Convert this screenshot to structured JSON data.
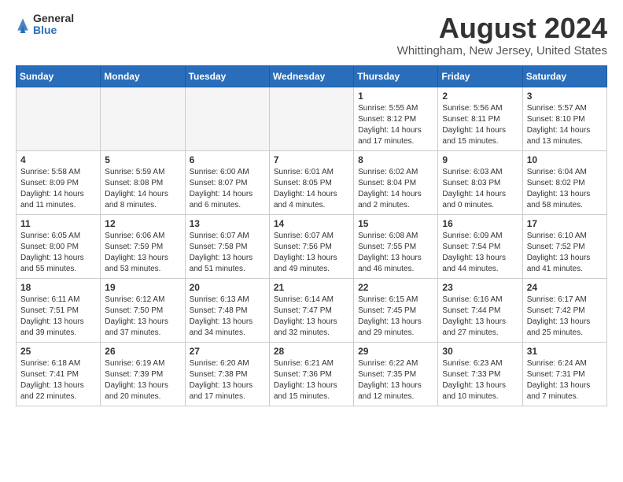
{
  "logo": {
    "general": "General",
    "blue": "Blue"
  },
  "title": "August 2024",
  "location": "Whittingham, New Jersey, United States",
  "headers": [
    "Sunday",
    "Monday",
    "Tuesday",
    "Wednesday",
    "Thursday",
    "Friday",
    "Saturday"
  ],
  "weeks": [
    [
      {
        "day": "",
        "sunrise": "",
        "sunset": "",
        "daylight": "",
        "empty": true
      },
      {
        "day": "",
        "sunrise": "",
        "sunset": "",
        "daylight": "",
        "empty": true
      },
      {
        "day": "",
        "sunrise": "",
        "sunset": "",
        "daylight": "",
        "empty": true
      },
      {
        "day": "",
        "sunrise": "",
        "sunset": "",
        "daylight": "",
        "empty": true
      },
      {
        "day": "1",
        "sunrise": "Sunrise: 5:55 AM",
        "sunset": "Sunset: 8:12 PM",
        "daylight": "Daylight: 14 hours and 17 minutes."
      },
      {
        "day": "2",
        "sunrise": "Sunrise: 5:56 AM",
        "sunset": "Sunset: 8:11 PM",
        "daylight": "Daylight: 14 hours and 15 minutes."
      },
      {
        "day": "3",
        "sunrise": "Sunrise: 5:57 AM",
        "sunset": "Sunset: 8:10 PM",
        "daylight": "Daylight: 14 hours and 13 minutes."
      }
    ],
    [
      {
        "day": "4",
        "sunrise": "Sunrise: 5:58 AM",
        "sunset": "Sunset: 8:09 PM",
        "daylight": "Daylight: 14 hours and 11 minutes."
      },
      {
        "day": "5",
        "sunrise": "Sunrise: 5:59 AM",
        "sunset": "Sunset: 8:08 PM",
        "daylight": "Daylight: 14 hours and 8 minutes."
      },
      {
        "day": "6",
        "sunrise": "Sunrise: 6:00 AM",
        "sunset": "Sunset: 8:07 PM",
        "daylight": "Daylight: 14 hours and 6 minutes."
      },
      {
        "day": "7",
        "sunrise": "Sunrise: 6:01 AM",
        "sunset": "Sunset: 8:05 PM",
        "daylight": "Daylight: 14 hours and 4 minutes."
      },
      {
        "day": "8",
        "sunrise": "Sunrise: 6:02 AM",
        "sunset": "Sunset: 8:04 PM",
        "daylight": "Daylight: 14 hours and 2 minutes."
      },
      {
        "day": "9",
        "sunrise": "Sunrise: 6:03 AM",
        "sunset": "Sunset: 8:03 PM",
        "daylight": "Daylight: 14 hours and 0 minutes."
      },
      {
        "day": "10",
        "sunrise": "Sunrise: 6:04 AM",
        "sunset": "Sunset: 8:02 PM",
        "daylight": "Daylight: 13 hours and 58 minutes."
      }
    ],
    [
      {
        "day": "11",
        "sunrise": "Sunrise: 6:05 AM",
        "sunset": "Sunset: 8:00 PM",
        "daylight": "Daylight: 13 hours and 55 minutes."
      },
      {
        "day": "12",
        "sunrise": "Sunrise: 6:06 AM",
        "sunset": "Sunset: 7:59 PM",
        "daylight": "Daylight: 13 hours and 53 minutes."
      },
      {
        "day": "13",
        "sunrise": "Sunrise: 6:07 AM",
        "sunset": "Sunset: 7:58 PM",
        "daylight": "Daylight: 13 hours and 51 minutes."
      },
      {
        "day": "14",
        "sunrise": "Sunrise: 6:07 AM",
        "sunset": "Sunset: 7:56 PM",
        "daylight": "Daylight: 13 hours and 49 minutes."
      },
      {
        "day": "15",
        "sunrise": "Sunrise: 6:08 AM",
        "sunset": "Sunset: 7:55 PM",
        "daylight": "Daylight: 13 hours and 46 minutes."
      },
      {
        "day": "16",
        "sunrise": "Sunrise: 6:09 AM",
        "sunset": "Sunset: 7:54 PM",
        "daylight": "Daylight: 13 hours and 44 minutes."
      },
      {
        "day": "17",
        "sunrise": "Sunrise: 6:10 AM",
        "sunset": "Sunset: 7:52 PM",
        "daylight": "Daylight: 13 hours and 41 minutes."
      }
    ],
    [
      {
        "day": "18",
        "sunrise": "Sunrise: 6:11 AM",
        "sunset": "Sunset: 7:51 PM",
        "daylight": "Daylight: 13 hours and 39 minutes."
      },
      {
        "day": "19",
        "sunrise": "Sunrise: 6:12 AM",
        "sunset": "Sunset: 7:50 PM",
        "daylight": "Daylight: 13 hours and 37 minutes."
      },
      {
        "day": "20",
        "sunrise": "Sunrise: 6:13 AM",
        "sunset": "Sunset: 7:48 PM",
        "daylight": "Daylight: 13 hours and 34 minutes."
      },
      {
        "day": "21",
        "sunrise": "Sunrise: 6:14 AM",
        "sunset": "Sunset: 7:47 PM",
        "daylight": "Daylight: 13 hours and 32 minutes."
      },
      {
        "day": "22",
        "sunrise": "Sunrise: 6:15 AM",
        "sunset": "Sunset: 7:45 PM",
        "daylight": "Daylight: 13 hours and 29 minutes."
      },
      {
        "day": "23",
        "sunrise": "Sunrise: 6:16 AM",
        "sunset": "Sunset: 7:44 PM",
        "daylight": "Daylight: 13 hours and 27 minutes."
      },
      {
        "day": "24",
        "sunrise": "Sunrise: 6:17 AM",
        "sunset": "Sunset: 7:42 PM",
        "daylight": "Daylight: 13 hours and 25 minutes."
      }
    ],
    [
      {
        "day": "25",
        "sunrise": "Sunrise: 6:18 AM",
        "sunset": "Sunset: 7:41 PM",
        "daylight": "Daylight: 13 hours and 22 minutes."
      },
      {
        "day": "26",
        "sunrise": "Sunrise: 6:19 AM",
        "sunset": "Sunset: 7:39 PM",
        "daylight": "Daylight: 13 hours and 20 minutes."
      },
      {
        "day": "27",
        "sunrise": "Sunrise: 6:20 AM",
        "sunset": "Sunset: 7:38 PM",
        "daylight": "Daylight: 13 hours and 17 minutes."
      },
      {
        "day": "28",
        "sunrise": "Sunrise: 6:21 AM",
        "sunset": "Sunset: 7:36 PM",
        "daylight": "Daylight: 13 hours and 15 minutes."
      },
      {
        "day": "29",
        "sunrise": "Sunrise: 6:22 AM",
        "sunset": "Sunset: 7:35 PM",
        "daylight": "Daylight: 13 hours and 12 minutes."
      },
      {
        "day": "30",
        "sunrise": "Sunrise: 6:23 AM",
        "sunset": "Sunset: 7:33 PM",
        "daylight": "Daylight: 13 hours and 10 minutes."
      },
      {
        "day": "31",
        "sunrise": "Sunrise: 6:24 AM",
        "sunset": "Sunset: 7:31 PM",
        "daylight": "Daylight: 13 hours and 7 minutes."
      }
    ]
  ]
}
